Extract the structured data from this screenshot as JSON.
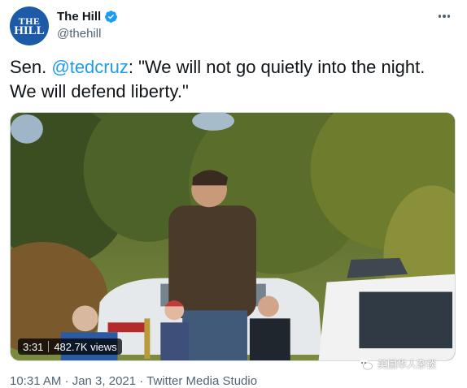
{
  "account": {
    "avatar_text": [
      "THE",
      "HILL"
    ],
    "name": "The Hill",
    "handle": "@thehill"
  },
  "tweet": {
    "prefix": "Sen. ",
    "mention": "@tedcruz",
    "quote_line1": ": \"We will not go quietly into the night.",
    "quote_line2": "We will defend liberty.\""
  },
  "media": {
    "duration": "3:31",
    "views": "482.7K views"
  },
  "watermark": "美国华人杂谈",
  "meta": {
    "timestamp": "10:31 AM · Jan 3, 2021 · Twitter Media Studio"
  },
  "colors": {
    "accent": "#1d9bf0",
    "avatar_bg": "#1d5aa8",
    "secondary_text": "#536471"
  },
  "icons": [
    "verified-badge-icon",
    "more-options-icon",
    "wechat-watermark-icon"
  ]
}
